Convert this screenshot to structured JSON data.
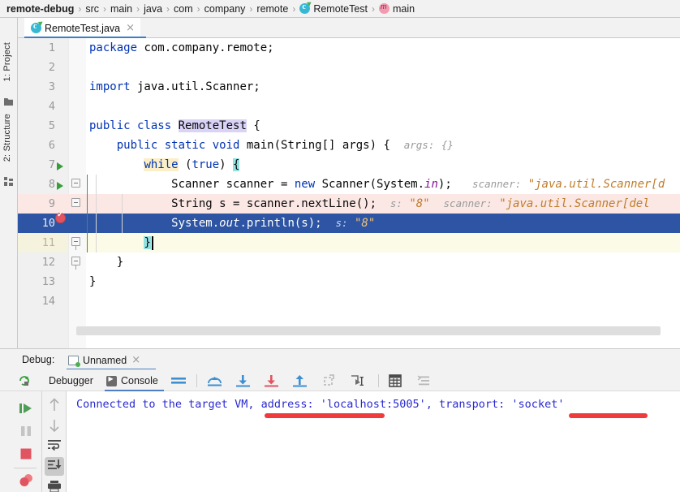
{
  "breadcrumb": {
    "items": [
      {
        "label": "remote-debug",
        "icon": null,
        "bold": true
      },
      {
        "label": "src",
        "icon": null,
        "bold": false
      },
      {
        "label": "main",
        "icon": null,
        "bold": false
      },
      {
        "label": "java",
        "icon": null,
        "bold": false
      },
      {
        "label": "com",
        "icon": null,
        "bold": false
      },
      {
        "label": "company",
        "icon": null,
        "bold": false
      },
      {
        "label": "remote",
        "icon": null,
        "bold": false
      },
      {
        "label": "RemoteTest",
        "icon": "class-icon",
        "bold": false
      },
      {
        "label": "main",
        "icon": "method-icon",
        "bold": false
      }
    ],
    "separator": "›"
  },
  "sidebar": {
    "project_label": "1: Project",
    "structure_label": "2: Structure",
    "project_icon": "folder-icon",
    "structure_icon": "structure-icon"
  },
  "editor_tab": {
    "label": "RemoteTest.java",
    "icon": "java-class-icon",
    "close": "×"
  },
  "editor": {
    "lines": [
      {
        "num": "1",
        "text": "package com.company.remote;"
      },
      {
        "num": "2",
        "text": ""
      },
      {
        "num": "3",
        "text": "import java.util.Scanner;"
      },
      {
        "num": "4",
        "text": ""
      },
      {
        "num": "5",
        "text": "public class RemoteTest {"
      },
      {
        "num": "6",
        "text": "    public static void main(String[] args) {",
        "hint": "args:",
        "hint_value": "{}"
      },
      {
        "num": "7",
        "text": "        while (true) {"
      },
      {
        "num": "8",
        "text": "            Scanner scanner = new Scanner(System.in);",
        "hint": "scanner:",
        "hint_value": "\"java.util.Scanner[d"
      },
      {
        "num": "9",
        "text": "            String s = scanner.nextLine();",
        "hint": "s:",
        "hint_value": "\"8\"",
        "hint2": "scanner:",
        "hint2_value": "\"java.util.Scanner[del"
      },
      {
        "num": "10",
        "text": "            System.out.println(s);",
        "hint": "s:",
        "hint_value": "\"8\""
      },
      {
        "num": "11",
        "text": "        }"
      },
      {
        "num": "12",
        "text": "    }"
      },
      {
        "num": "13",
        "text": "}"
      },
      {
        "num": "14",
        "text": ""
      }
    ],
    "breakpoint_line": "9",
    "execution_line": "10",
    "caret_line": "11",
    "run_marker_lines": [
      "5",
      "6"
    ],
    "highlighted_identifier": "RemoteTest",
    "colors": {
      "keyword": "#0033b3",
      "string": "#067d17",
      "field": "#871094",
      "hint": "#9a9a9a",
      "hint_value": "#c07c29",
      "execution_line_bg": "#2e55a3",
      "breakpoint_line_bg": "#fbe8e4",
      "caret_line_bg": "#fcfbe8"
    }
  },
  "debug": {
    "panel_title": "Debug:",
    "session_tab": "Unnamed",
    "session_close": "×",
    "session_icon": "run-configuration-icon",
    "tabs": [
      {
        "label": "Debugger",
        "icon": null,
        "active": false
      },
      {
        "label": "Console",
        "icon": "console-icon",
        "active": true
      }
    ],
    "toolbar_icons": [
      "layout-icon",
      "step-over-icon",
      "step-into-icon",
      "force-step-into-icon",
      "step-out-icon",
      "drop-frame-icon",
      "run-to-cursor-icon",
      "evaluate-expression-icon",
      "settings-icon"
    ],
    "left_actions": [
      "resume-program-icon",
      "pause-program-icon",
      "stop-icon",
      "mute-breakpoints-icon"
    ],
    "left_actions2": [
      "scroll-up-icon",
      "scroll-down-icon",
      "soft-wrap-icon",
      "scroll-to-end-icon",
      "print-icon"
    ],
    "console": {
      "text": "Connected to the target VM, address: 'localhost:5005', transport: 'socket'",
      "text_color": "#2a2ad0",
      "annotations": [
        {
          "label": "localhost:5005",
          "color": "#ef3b3b"
        },
        {
          "label": "socket",
          "color": "#ef3b3b"
        }
      ]
    }
  }
}
